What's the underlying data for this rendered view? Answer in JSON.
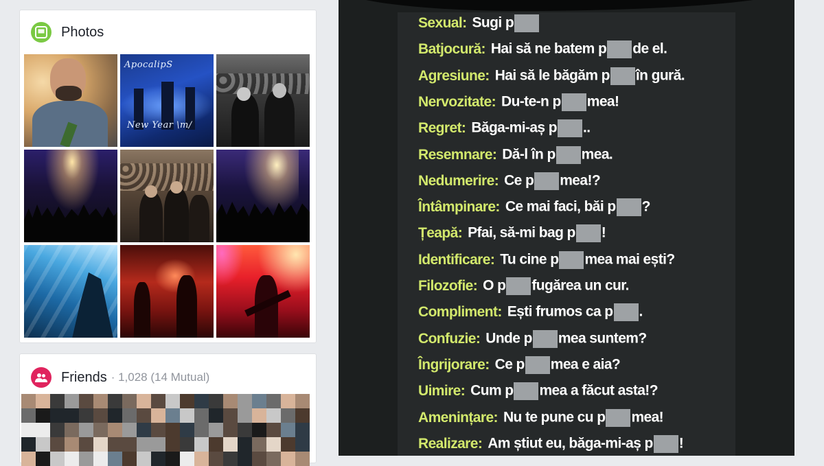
{
  "photos": {
    "title": "Photos",
    "icon": "photos-icon",
    "accent": "#7ac943",
    "thumbnails": [
      {
        "name": "photo-man-portrait",
        "caption": ""
      },
      {
        "name": "photo-apocalips-new-year",
        "caption_top": "ApocalipS",
        "caption_bottom": "New Year \\m/"
      },
      {
        "name": "photo-band-crowd-bw",
        "caption": ""
      },
      {
        "name": "photo-concert-crowd-1",
        "caption": ""
      },
      {
        "name": "photo-band-group",
        "caption": ""
      },
      {
        "name": "photo-concert-crowd-2",
        "caption": ""
      },
      {
        "name": "photo-blue-stage",
        "caption": ""
      },
      {
        "name": "photo-red-stage",
        "caption": ""
      },
      {
        "name": "photo-red-guitarist",
        "caption": ""
      }
    ]
  },
  "friends": {
    "title": "Friends",
    "count": "· 1,028 (14 Mutual)",
    "icon": "friends-icon",
    "accent": "#e0245e"
  },
  "post": {
    "lines": [
      {
        "label": "Sexual:",
        "parts": [
          "Sugi p",
          "#",
          ""
        ]
      },
      {
        "label": "Batjocură:",
        "parts": [
          "Hai să ne batem p",
          "#",
          "de el."
        ]
      },
      {
        "label": "Agresiune:",
        "parts": [
          "Hai să le băgăm p",
          "#",
          "în gură."
        ]
      },
      {
        "label": "Nervozitate:",
        "parts": [
          "Du-te-n p",
          "#",
          "mea!"
        ]
      },
      {
        "label": "Regret:",
        "parts": [
          "Băga-mi-aș p",
          "#",
          ".."
        ]
      },
      {
        "label": "Resemnare:",
        "parts": [
          "Dă-l în p",
          "#",
          "mea."
        ]
      },
      {
        "label": "Nedumerire:",
        "parts": [
          "Ce p",
          "#",
          "mea!?"
        ]
      },
      {
        "label": "Întâmpinare:",
        "parts": [
          "Ce mai faci, băi p",
          "#",
          "?"
        ]
      },
      {
        "label": "Țeapă:",
        "parts": [
          "Pfai, să-mi bag p",
          "#",
          "!"
        ]
      },
      {
        "label": "Identificare:",
        "parts": [
          "Tu cine p",
          "#",
          "mea mai ești?"
        ]
      },
      {
        "label": "Filozofie:",
        "parts": [
          "O p",
          "#",
          "fugărea un cur."
        ]
      },
      {
        "label": "Compliment:",
        "parts": [
          "Ești frumos ca p",
          "#",
          "."
        ]
      },
      {
        "label": "Confuzie:",
        "parts": [
          "Unde p",
          "#",
          "mea suntem?"
        ]
      },
      {
        "label": "Îngrijorare:",
        "parts": [
          "Ce p",
          "#",
          "mea e aia?"
        ]
      },
      {
        "label": "Uimire:",
        "parts": [
          "Cum p",
          "#",
          "mea a făcut asta!?"
        ]
      },
      {
        "label": "Amenințare:",
        "parts": [
          "Nu te pune cu p",
          "#",
          "mea!"
        ]
      },
      {
        "label": "Realizare:",
        "parts": [
          "Am știut eu, băga-mi-aș p",
          "#",
          "!"
        ]
      }
    ]
  }
}
